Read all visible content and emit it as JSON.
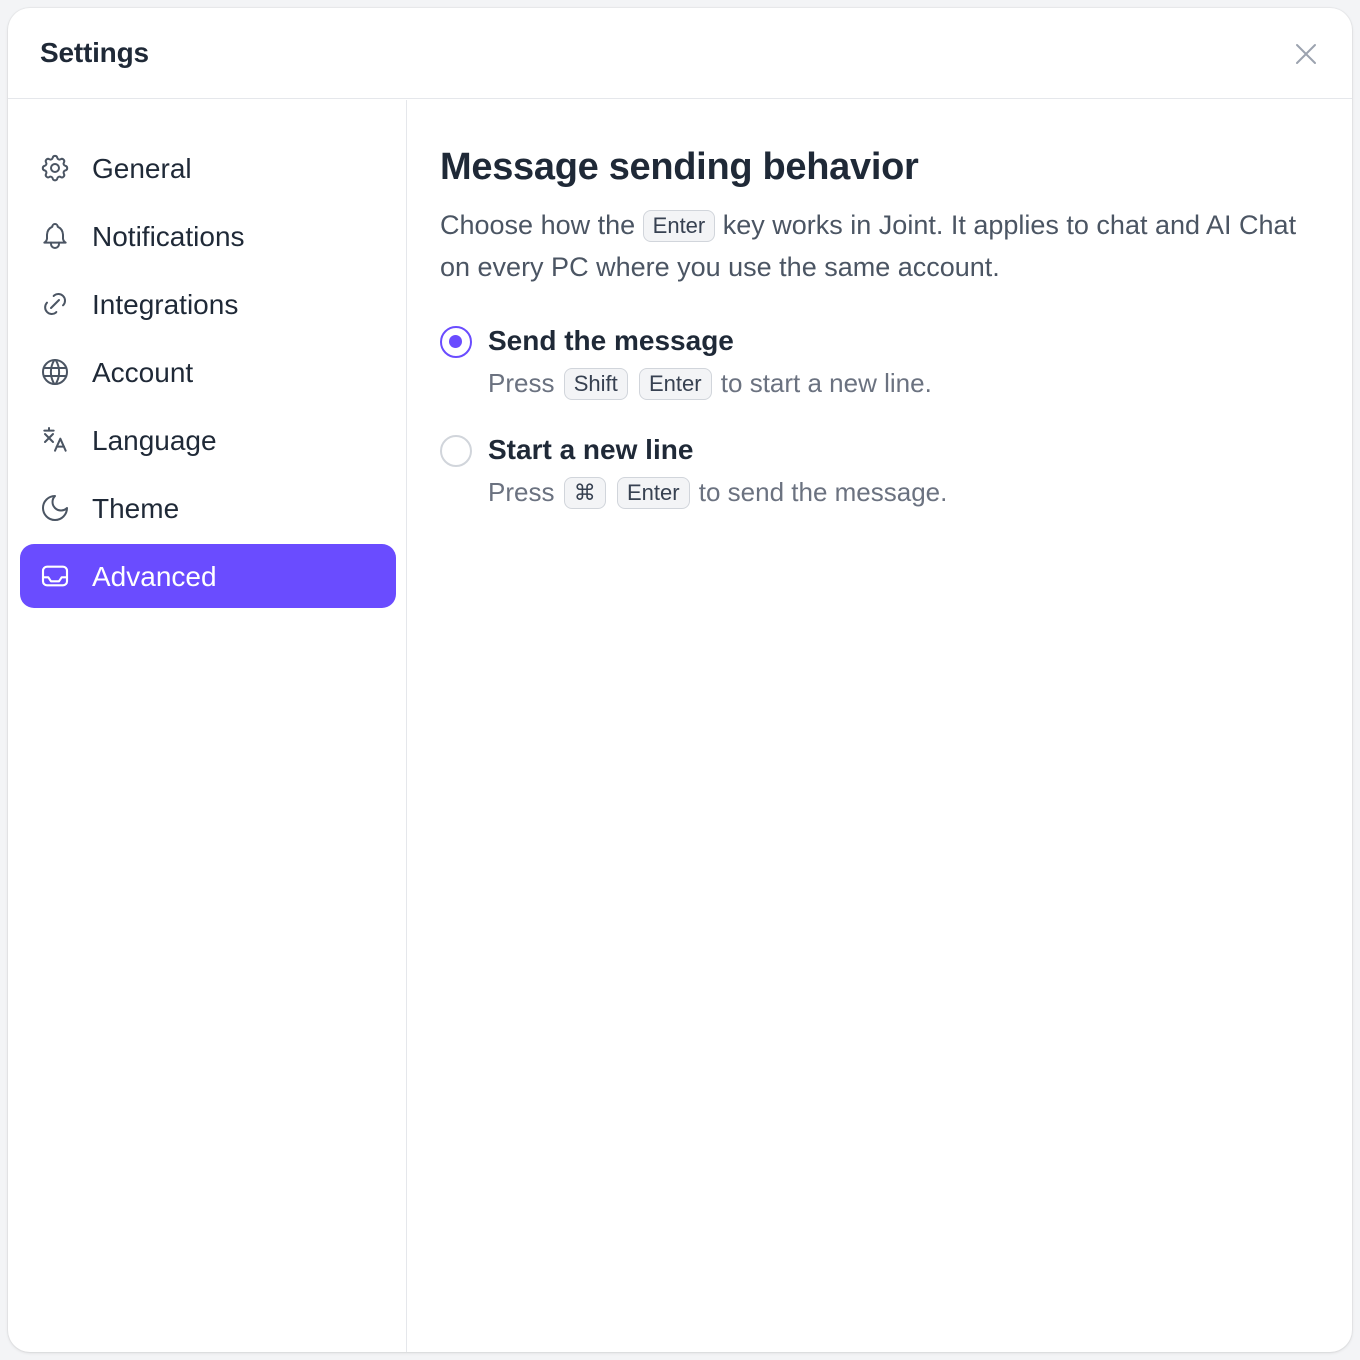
{
  "window": {
    "title": "Settings",
    "close_icon": "close-icon"
  },
  "sidebar": {
    "items": [
      {
        "label": "General",
        "icon": "gear-icon",
        "active": false
      },
      {
        "label": "Notifications",
        "icon": "bell-icon",
        "active": false
      },
      {
        "label": "Integrations",
        "icon": "link-icon",
        "active": false
      },
      {
        "label": "Account",
        "icon": "globe-icon",
        "active": false
      },
      {
        "label": "Language",
        "icon": "translate-icon",
        "active": false
      },
      {
        "label": "Theme",
        "icon": "moon-icon",
        "active": false
      },
      {
        "label": "Advanced",
        "icon": "inbox-icon",
        "active": true
      }
    ]
  },
  "main": {
    "heading": "Message sending behavior",
    "description": {
      "before": "Choose how the",
      "key": "Enter",
      "after": "key works in Joint. It applies to chat and AI Chat on every PC where you use the same account."
    },
    "options": [
      {
        "title": "Send the message",
        "checked": true,
        "hint_prefix": "Press",
        "keys": [
          "Shift",
          "Enter"
        ],
        "hint_suffix": "to start a new line."
      },
      {
        "title": "Start a new line",
        "checked": false,
        "hint_prefix": "Press",
        "keys": [
          "⌘",
          "Enter"
        ],
        "hint_suffix": "to send the message."
      }
    ]
  },
  "colors": {
    "accent": "#6a4cff",
    "text": "#1f2937",
    "muted": "#6b7280",
    "border": "#e5e7eb"
  }
}
